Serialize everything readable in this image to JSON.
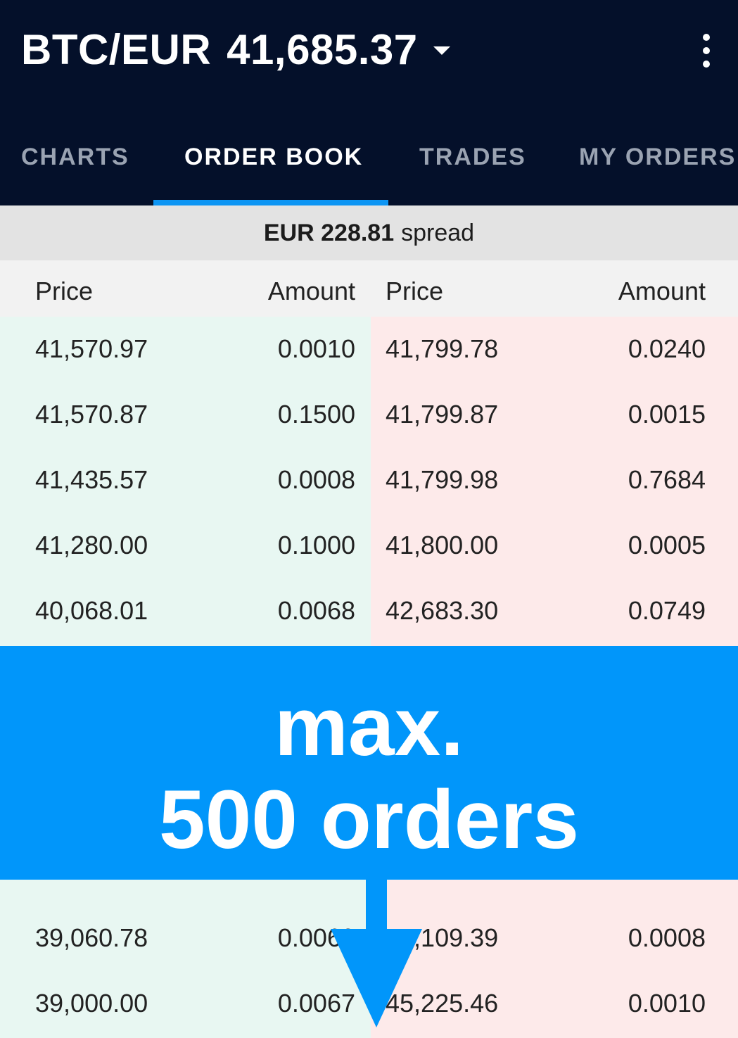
{
  "header": {
    "pair": "BTC/EUR",
    "price": "41,685.37",
    "menu_icon": "kebab-menu-icon",
    "caret_icon": "chevron-down-icon"
  },
  "tabs": [
    {
      "label": "CHARTS",
      "active": false
    },
    {
      "label": "ORDER BOOK",
      "active": true
    },
    {
      "label": "TRADES",
      "active": false
    },
    {
      "label": "MY ORDERS",
      "active": false
    }
  ],
  "spread": {
    "value": "EUR 228.81",
    "label": "spread"
  },
  "columns": {
    "bid_price": "Price",
    "bid_amount": "Amount",
    "ask_price": "Price",
    "ask_amount": "Amount"
  },
  "rows": [
    {
      "bid_price": "41,570.97",
      "bid_amount": "0.0010",
      "ask_price": "41,799.78",
      "ask_amount": "0.0240"
    },
    {
      "bid_price": "41,570.87",
      "bid_amount": "0.1500",
      "ask_price": "41,799.87",
      "ask_amount": "0.0015"
    },
    {
      "bid_price": "41,435.57",
      "bid_amount": "0.0008",
      "ask_price": "41,799.98",
      "ask_amount": "0.7684"
    },
    {
      "bid_price": "41,280.00",
      "bid_amount": "0.1000",
      "ask_price": "41,800.00",
      "ask_amount": "0.0005"
    },
    {
      "bid_price": "40,068.01",
      "bid_amount": "0.0068",
      "ask_price": "42,683.30",
      "ask_amount": "0.0749"
    },
    {
      "bid_price": "39,060.78",
      "bid_amount": "0.0069",
      "ask_price": "45,109.39",
      "ask_amount": "0.0008"
    },
    {
      "bid_price": "39,000.00",
      "bid_amount": "0.0067",
      "ask_price": "45,225.46",
      "ask_amount": "0.0010"
    }
  ],
  "overlay": {
    "line1": "max.",
    "line2": "500 orders",
    "arrow_icon": "arrow-down-icon"
  },
  "colors": {
    "header_bg": "#04102a",
    "accent": "#0d95f3",
    "banner_bg": "#0196fa",
    "bid_bg": "#e8f7f2",
    "ask_bg": "#fdeaea"
  }
}
